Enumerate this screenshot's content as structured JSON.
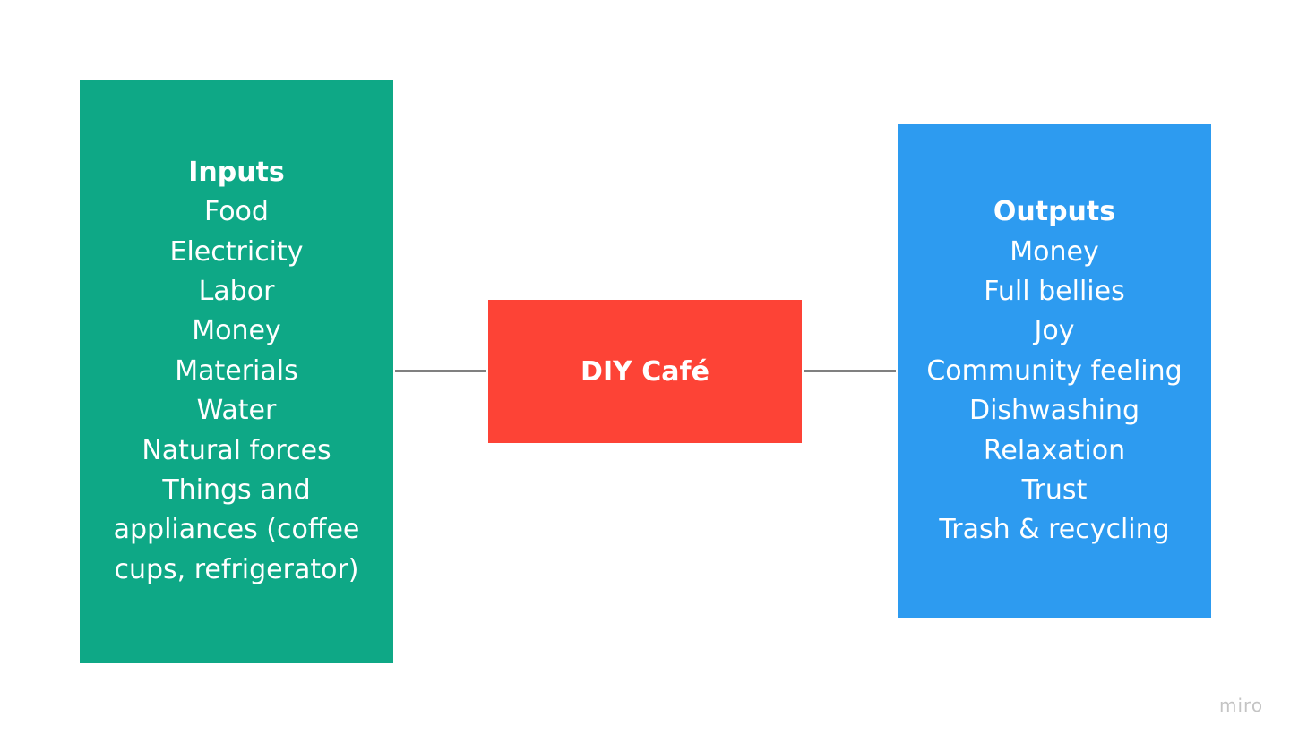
{
  "colors": {
    "inputs": "#0ea886",
    "center": "#fd4336",
    "outputs": "#2d9bf0",
    "connector": "#808080"
  },
  "inputs": {
    "title": "Inputs",
    "items": [
      "Food",
      "Electricity",
      "Labor",
      "Money",
      "Materials",
      "Water",
      "Natural forces",
      "Things and",
      "appliances (coffee",
      "cups, refrigerator)"
    ]
  },
  "center": {
    "title": "DIY Café"
  },
  "outputs": {
    "title": "Outputs",
    "items": [
      "Money",
      "Full bellies",
      "Joy",
      "Community feeling",
      "Dishwashing",
      "Relaxation",
      "Trust",
      "Trash & recycling"
    ]
  },
  "brand": "miro"
}
